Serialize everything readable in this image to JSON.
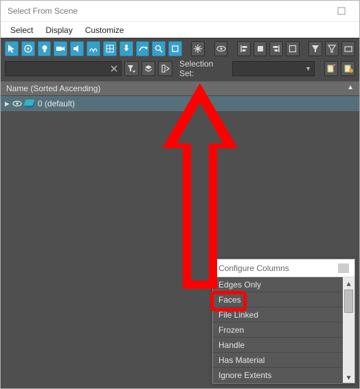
{
  "window": {
    "title": "Select From Scene"
  },
  "menu": {
    "select": "Select",
    "display": "Display",
    "customize": "Customize"
  },
  "toolbar1": {
    "icons": [
      "cursor",
      "target",
      "lightbulb",
      "camera",
      "speaker",
      "lattice",
      "plane-grid",
      "biped-grid",
      "tape",
      "magnifier",
      "square",
      "snowflake",
      "eye",
      "left-align",
      "center-align",
      "right-align",
      "box-outline",
      "funnel",
      "funnel-outline",
      "box-small"
    ]
  },
  "toolbar2": {
    "search_placeholder": "",
    "icons": [
      "funnel-dropdown",
      "layers-stack",
      "bracket-angle"
    ],
    "selset_label": "Selection Set:",
    "end_icons": [
      "document-pencil",
      "document-plus"
    ]
  },
  "column_header": "Name (Sorted Ascending)",
  "tree": {
    "root": "0 (default)"
  },
  "popup": {
    "title": "Configure Columns",
    "items": [
      "Edges Only",
      "Faces",
      "File Linked",
      "Frozen",
      "Handle",
      "Has Material",
      "Ignore Extents"
    ]
  }
}
